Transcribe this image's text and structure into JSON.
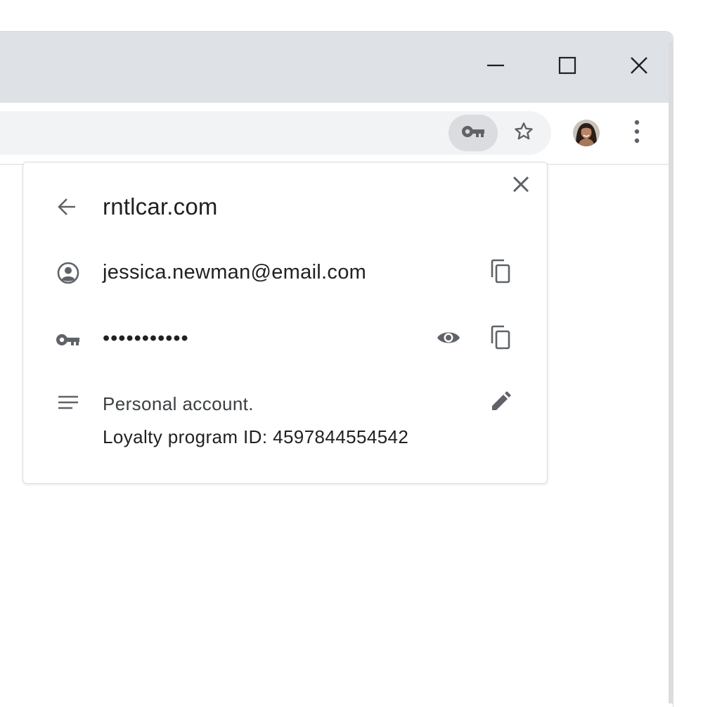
{
  "browser": {
    "window_controls": {
      "minimize_icon": "minimize-icon",
      "maximize_icon": "maximize-icon",
      "close_icon": "close-icon"
    },
    "toolbar": {
      "password_key_icon": "key-icon",
      "bookmark_icon": "star-icon",
      "menu_icon": "more-vert-icon"
    }
  },
  "password_bubble": {
    "site": "rntlcar.com",
    "username": "jessica.newman@email.com",
    "password_masked": "•••••••••••",
    "note_line1": "Personal account.",
    "note_line2": "Loyalty program ID: 4597844554542"
  },
  "colors": {
    "titlebar": "#dee1e6",
    "omnibox": "#f1f3f4",
    "key_chip": "#dadce0",
    "icon_gray": "#5f6368",
    "text": "#202124"
  }
}
